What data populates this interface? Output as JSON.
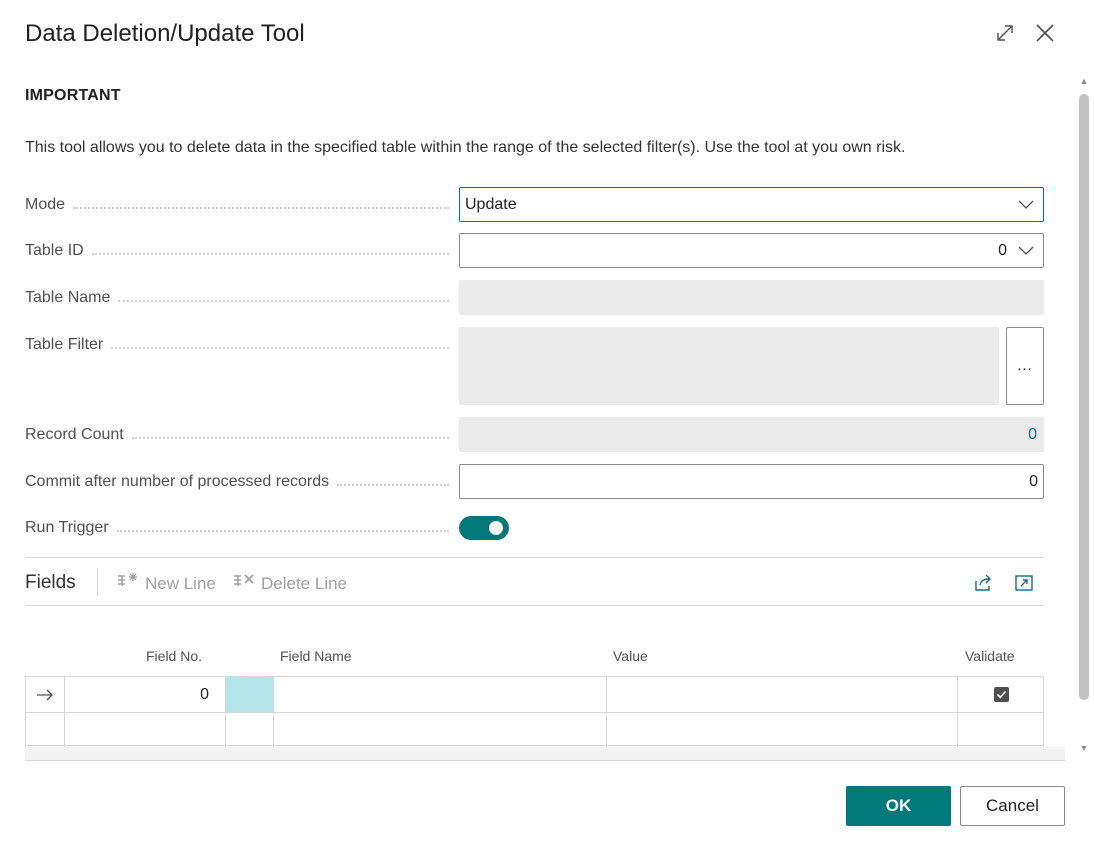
{
  "dialog": {
    "title": "Data Deletion/Update Tool",
    "expand_icon": "expand-icon",
    "close_icon": "close-icon"
  },
  "section": {
    "title": "IMPORTANT",
    "info": "This tool allows you to delete data in the specified table within the range of the selected filter(s). Use the tool at you own risk."
  },
  "fields": {
    "mode": {
      "label": "Mode",
      "value": "Update"
    },
    "table_id": {
      "label": "Table ID",
      "value": "0"
    },
    "table_name": {
      "label": "Table Name",
      "value": ""
    },
    "table_filter": {
      "label": "Table Filter",
      "value": "",
      "assist": "…"
    },
    "record_count": {
      "label": "Record Count",
      "value": "0"
    },
    "commit_after": {
      "label": "Commit after number of processed records",
      "value": "0"
    },
    "run_trigger": {
      "label": "Run Trigger",
      "value": true
    }
  },
  "fields_part": {
    "title": "Fields",
    "actions": {
      "new_line": "New Line",
      "delete_line": "Delete Line"
    },
    "columns": {
      "field_no": "Field No.",
      "field_name": "Field Name",
      "value": "Value",
      "validate": "Validate"
    },
    "rows": [
      {
        "field_no": "0",
        "field_name": "",
        "value": "",
        "validate": true
      }
    ]
  },
  "buttons": {
    "ok": "OK",
    "cancel": "Cancel"
  },
  "colors": {
    "accent": "#00797a",
    "selected_cell": "#b3e5ea",
    "link": "#1a6a8a"
  }
}
